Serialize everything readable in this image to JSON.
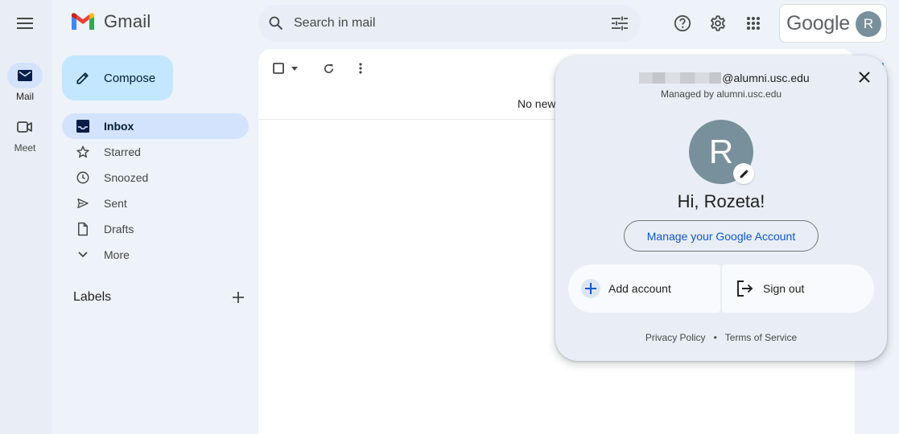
{
  "app": {
    "name": "Gmail"
  },
  "rail": [
    {
      "label": "Mail",
      "icon": "mail-icon",
      "active": true
    },
    {
      "label": "Meet",
      "icon": "video-icon",
      "active": false
    }
  ],
  "compose": {
    "label": "Compose"
  },
  "nav": [
    {
      "label": "Inbox",
      "icon": "inbox-icon",
      "active": true
    },
    {
      "label": "Starred",
      "icon": "star-icon"
    },
    {
      "label": "Snoozed",
      "icon": "clock-icon"
    },
    {
      "label": "Sent",
      "icon": "send-icon"
    },
    {
      "label": "Drafts",
      "icon": "draft-icon"
    },
    {
      "label": "More",
      "icon": "chevron-down-icon"
    }
  ],
  "labels": {
    "title": "Labels"
  },
  "search": {
    "placeholder": "Search in mail"
  },
  "header": {
    "google_word": "Google",
    "avatar_letter": "R"
  },
  "main": {
    "empty_text": "No new"
  },
  "popup": {
    "email_suffix": "@alumni.usc.edu",
    "managed": "Managed by alumni.usc.edu",
    "avatar_letter": "R",
    "greeting": "Hi, Rozeta!",
    "manage_label": "Manage your Google Account",
    "add_account": "Add account",
    "sign_out": "Sign out",
    "privacy": "Privacy Policy",
    "dot": "•",
    "terms": "Terms of Service"
  },
  "colors": {
    "accent": "#0b57d0",
    "compose_bg": "#c2e7ff",
    "active_bg": "#d3e3fd",
    "avatar": "#78909c",
    "page_bg": "#eef2f9"
  }
}
